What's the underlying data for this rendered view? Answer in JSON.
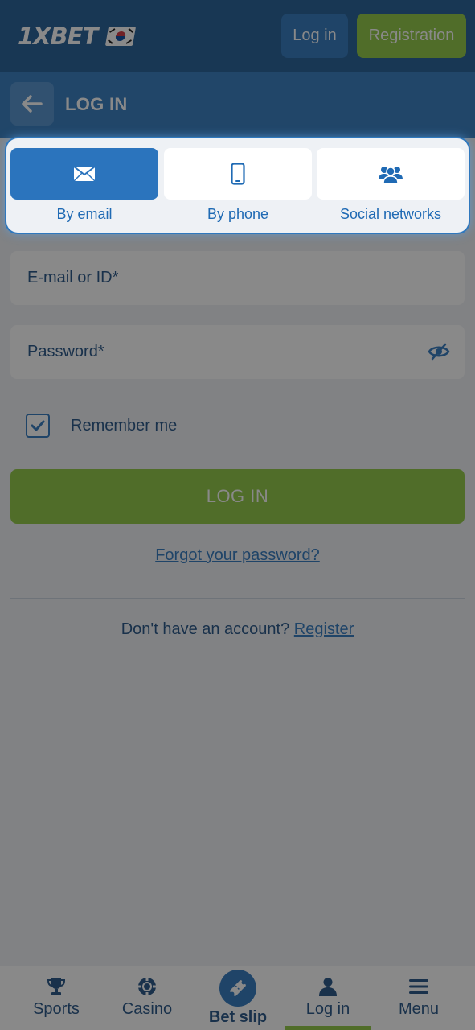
{
  "header": {
    "logo_text": "1XBET",
    "login_label": "Log in",
    "registration_label": "Registration"
  },
  "subheader": {
    "title": "LOG IN"
  },
  "login_methods": [
    {
      "label": "By email",
      "icon": "envelope-icon",
      "active": true
    },
    {
      "label": "By phone",
      "icon": "smartphone-icon",
      "active": false
    },
    {
      "label": "Social networks",
      "icon": "people-group-icon",
      "active": false
    }
  ],
  "form": {
    "email_placeholder": "E-mail or ID*",
    "password_placeholder": "Password*",
    "remember_label": "Remember me",
    "remember_checked": true,
    "submit_label": "LOG IN",
    "forgot_label": "Forgot your password?",
    "no_account_text": "Don't have an account?",
    "register_label": "Register"
  },
  "bottom_nav": [
    {
      "label": "Sports",
      "icon": "trophy-icon"
    },
    {
      "label": "Casino",
      "icon": "casino-chip-icon"
    },
    {
      "label": "Bet slip",
      "icon": "ticket-icon"
    },
    {
      "label": "Log in",
      "icon": "user-icon",
      "active": true
    },
    {
      "label": "Menu",
      "icon": "hamburger-menu-icon"
    }
  ],
  "colors": {
    "brand_blue": "#1c5a95",
    "accent_blue": "#2b74bd",
    "accent_green": "#8cc63f"
  }
}
